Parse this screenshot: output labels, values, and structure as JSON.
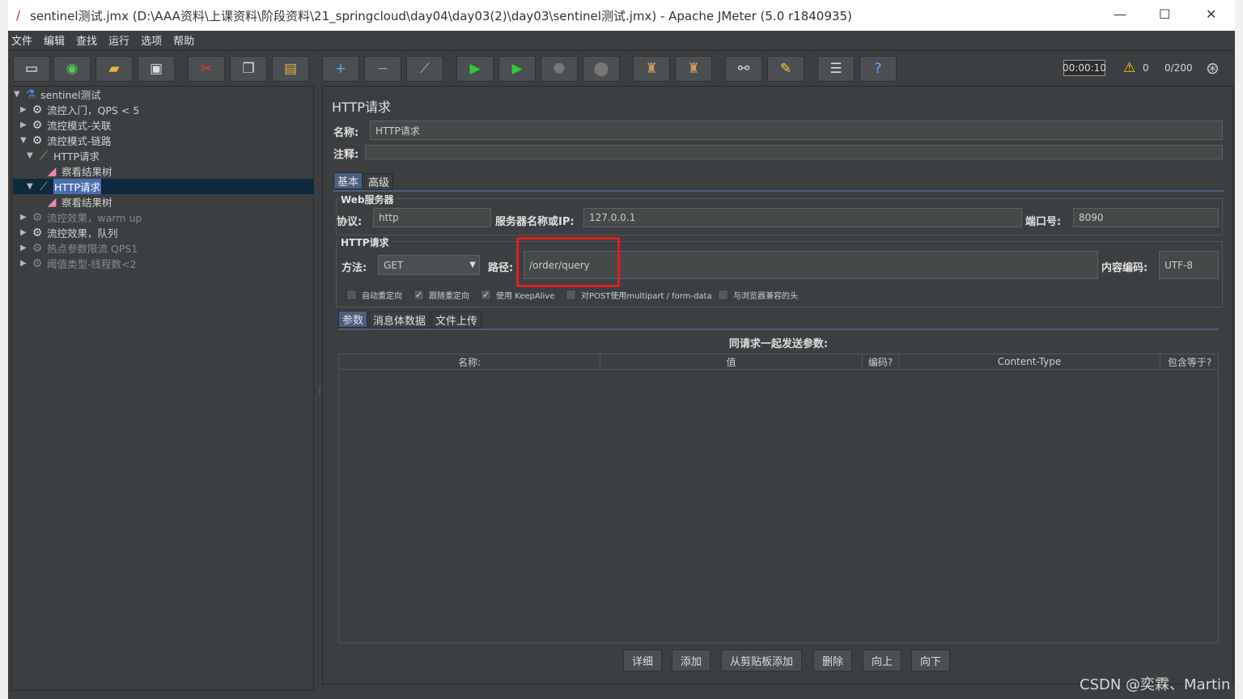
{
  "window": {
    "title": "sentinel测试.jmx (D:\\AAA资料\\上课资料\\阶段资料\\21_springcloud\\day04\\day03(2)\\day03\\sentinel测试.jmx) - Apache JMeter (5.0 r1840935)",
    "minimize": "—",
    "maximize": "☐",
    "close": "✕"
  },
  "menu": [
    "文件",
    "编辑",
    "查找",
    "运行",
    "选项",
    "帮助"
  ],
  "status": {
    "timer": "00:00:10",
    "warnings": "0",
    "threads": "0/200"
  },
  "tree": [
    {
      "label": "sentinel测试",
      "icon": "flask-icon"
    },
    {
      "label": "流控入门，QPS < 5",
      "icon": "gear-icon"
    },
    {
      "label": "流控模式-关联",
      "icon": "gear-icon"
    },
    {
      "label": "流控模式-链路",
      "icon": "gear-icon"
    },
    {
      "label": "HTTP请求",
      "icon": "pipette-icon"
    },
    {
      "label": "察看结果树",
      "icon": "chart-icon"
    },
    {
      "label": "HTTP请求",
      "icon": "pipette-icon"
    },
    {
      "label": "察看结果树",
      "icon": "chart-icon"
    },
    {
      "label": "流控效果，warm up",
      "icon": "gear-icon"
    },
    {
      "label": "流控效果，队列",
      "icon": "gear-icon"
    },
    {
      "label": "热点参数限流 QPS1",
      "icon": "gear-icon"
    },
    {
      "label": "阈值类型-线程数<2",
      "icon": "gear-icon"
    }
  ],
  "panel": {
    "title": "HTTP请求",
    "name_label": "名称:",
    "name_value": "HTTP请求",
    "comment_label": "注释:",
    "tabs": [
      "基本",
      "高级"
    ],
    "web_server": {
      "legend": "Web服务器",
      "protocol_label": "协议:",
      "protocol": "http",
      "server_label": "服务器名称或IP:",
      "server": "127.0.0.1",
      "port_label": "端口号:",
      "port": "8090"
    },
    "http": {
      "legend": "HTTP请求",
      "method_label": "方法:",
      "method": "GET",
      "path_label": "路径:",
      "path": "/order/query",
      "encoding_label": "内容编码:",
      "encoding": "UTF-8"
    },
    "checkboxes": [
      {
        "label": "自动重定向",
        "checked": false
      },
      {
        "label": "跟随重定向",
        "checked": true
      },
      {
        "label": "使用 KeepAlive",
        "checked": true
      },
      {
        "label": "对POST使用multipart / form-data",
        "checked": false
      },
      {
        "label": "与浏览器兼容的头",
        "checked": false
      }
    ],
    "subtabs": [
      "参数",
      "消息体数据",
      "文件上传"
    ],
    "params_title": "同请求一起发送参数:",
    "columns": [
      "名称:",
      "值",
      "编码?",
      "Content-Type",
      "包含等于?"
    ],
    "buttons": [
      "详细",
      "添加",
      "从剪贴板添加",
      "删除",
      "向上",
      "向下"
    ]
  },
  "watermark": "CSDN @奕霖、Martin",
  "highlight_color": "#e02020"
}
